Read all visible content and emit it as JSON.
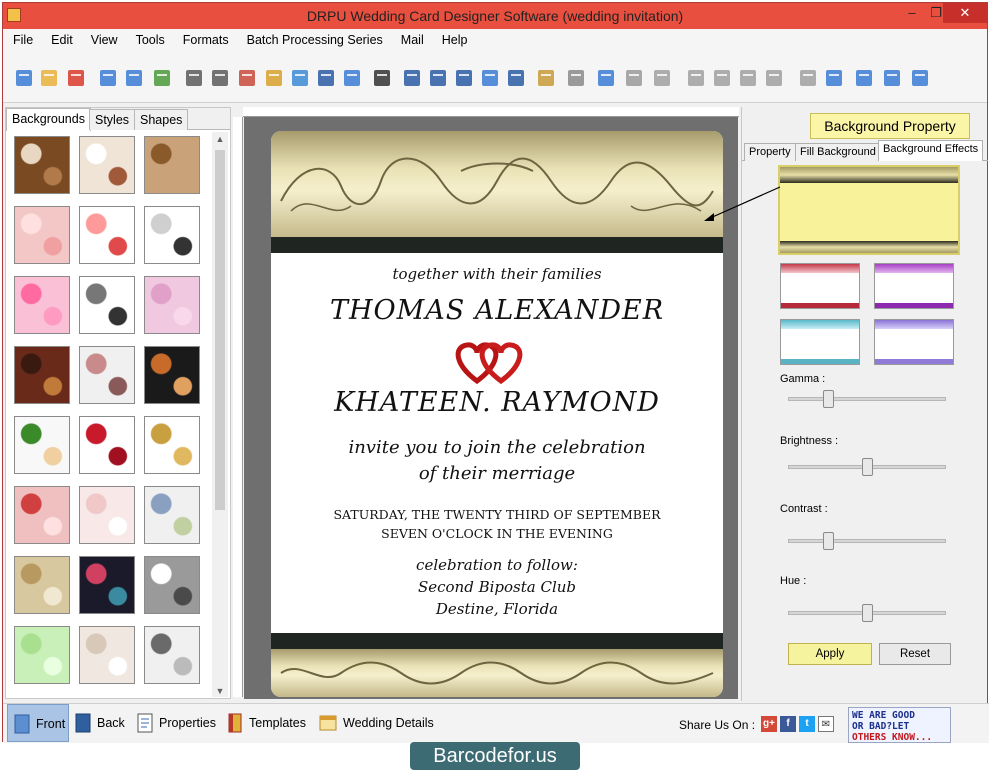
{
  "window": {
    "title": "DRPU Wedding Card Designer Software (wedding invitation)"
  },
  "menu": [
    "File",
    "Edit",
    "View",
    "Tools",
    "Formats",
    "Batch Processing Series",
    "Mail",
    "Help"
  ],
  "toolbar": {
    "icons": [
      "new-icon",
      "open-icon",
      "close-doc-icon",
      "save-icon",
      "save-as-icon",
      "export-icon",
      "print-preview-icon",
      "print-icon",
      "copy-style-icon",
      "gift-icon",
      "image-icon",
      "pen-icon",
      "picture-icon",
      "barcode-icon",
      "text-icon",
      "text-style-icon",
      "signature-icon",
      "mail-icon",
      "line-icon",
      "database-icon",
      "database2-icon",
      "undo-icon",
      "redo-icon",
      "cut-icon",
      "copy-icon",
      "paste-icon",
      "delete-icon",
      "bring-front-icon",
      "send-back-icon",
      "grid-icon",
      "one-to-one-icon",
      "fit-icon",
      "zoom-icon"
    ]
  },
  "left_panel": {
    "tabs": [
      "Backgrounds",
      "Styles",
      "Shapes"
    ],
    "active_tab": "Backgrounds"
  },
  "card": {
    "line1": "together with their families",
    "groom": "THOMAS ALEXANDER",
    "bride": "KHATEEN. RAYMOND",
    "invite1": "invite you to join the celebration",
    "invite2": "of their merriage",
    "date": "SATURDAY, THE TWENTY THIRD OF SEPTEMBER",
    "time": "SEVEN O'CLOCK IN THE EVENING",
    "follow": "celebration to follow:",
    "venue": "Second Biposta Club",
    "place": "Destine, Florida"
  },
  "right_panel": {
    "heading": "Background Property",
    "tabs": [
      "Property",
      "Fill Background",
      "Background Effects"
    ],
    "active_tab": "Background Effects",
    "sliders": [
      {
        "label": "Gamma :",
        "level": 0.23
      },
      {
        "label": "Brightness :",
        "level": 0.5
      },
      {
        "label": "Contrast :",
        "level": 0.23
      },
      {
        "label": "Hue :",
        "level": 0.5
      }
    ],
    "apply_label": "Apply",
    "reset_label": "Reset"
  },
  "statusbar": {
    "buttons": [
      "Front",
      "Back",
      "Properties",
      "Templates",
      "Wedding Details"
    ],
    "active": "Front",
    "share_label": "Share Us On :",
    "badge_line1": "WE ARE GOOD",
    "badge_line2": "OR BAD?LET",
    "badge_line3": "OTHERS KNOW..."
  },
  "footer": {
    "logo": "Barcodefor.us"
  }
}
